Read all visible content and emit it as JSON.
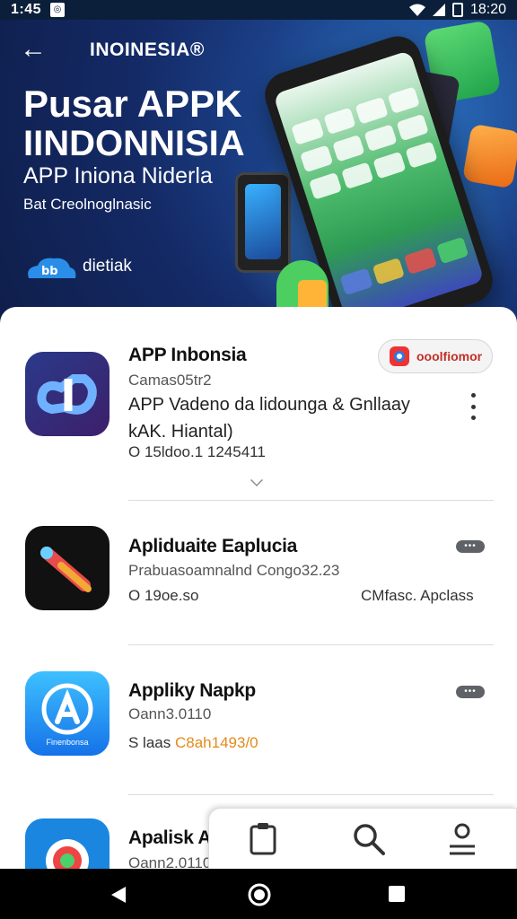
{
  "status_bar": {
    "time": "1:45",
    "right_time": "18:20"
  },
  "header": {
    "brand": "INOINESIA®",
    "title_line1": "Pusar APPK",
    "title_line2": "IINDONNISIA",
    "subtitle": "APP Iniona Niderla",
    "tagline": "Bat Creolnoglnasic",
    "logo_text": "dietiak"
  },
  "apps": [
    {
      "name": "APP Inbonsia",
      "sub": "Camas05tr2",
      "desc": "APP Vadeno da lidounga & Gnllaay kAK. Hiantal)",
      "meta": "O 15ldoo.1 1245411",
      "chip_label": "ooolfiomor"
    },
    {
      "name": "Apliduaite Eaplucia",
      "sub": "Prabuasoamnalnd Congo32.23",
      "meta": "O 19oe.so",
      "meta_right": "CMfasc. Apclass",
      "pill": "•••"
    },
    {
      "name": "Appliky Napkp",
      "sub": "Oann3.0110",
      "meta_prefix": "S laas",
      "meta_highlight": "C8ah1493/0",
      "icon_caption": "Finenbonsa",
      "pill": "•••"
    },
    {
      "name": "Apalisk A",
      "sub": "Oann2.0110"
    }
  ],
  "colors": {
    "accent_orange": "#e48a1a",
    "hero_bg": "#142a66"
  }
}
